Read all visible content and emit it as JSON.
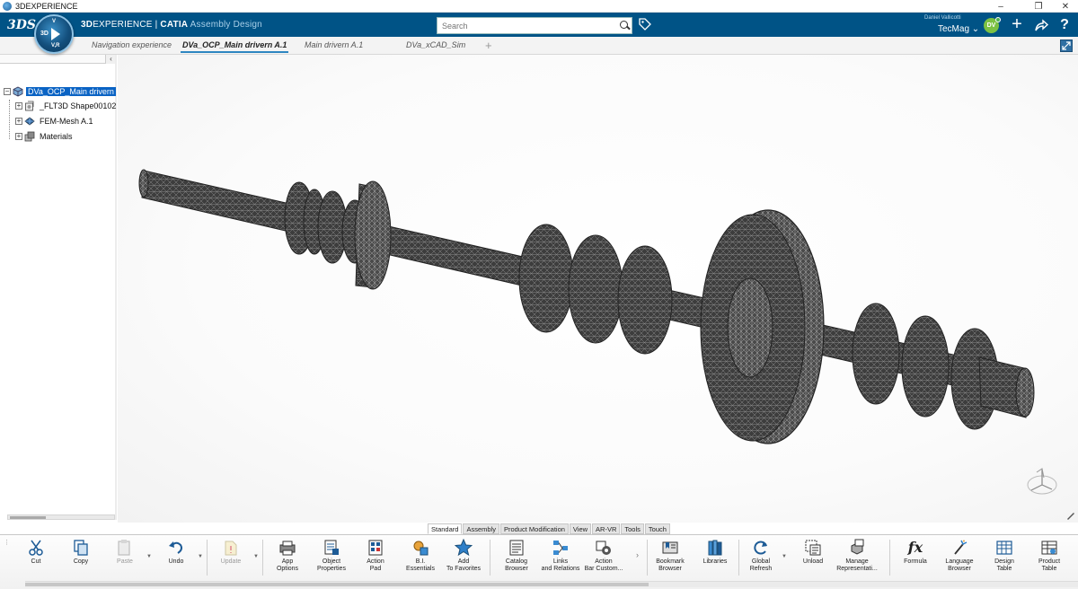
{
  "window": {
    "title": "3DEXPERIENCE"
  },
  "header": {
    "logo_text": "3DS",
    "compass": {
      "left": "3D",
      "top": "V",
      "bottom": "V,R"
    },
    "brand_prefix": "3D",
    "brand_main": "EXPERIENCE",
    "brand_sep": " | ",
    "brand_app": "CATIA",
    "brand_workbench": "Assembly Design",
    "search_placeholder": "Search",
    "user_name": "Daniel Vallicotti",
    "tenant": "TecMag",
    "avatar_initials": "DV"
  },
  "tabs": [
    {
      "label": "Navigation experience",
      "active": false
    },
    {
      "label": "DVa_OCP_Main drivern A.1",
      "active": true
    },
    {
      "label": "Main drivern A.1",
      "active": false
    },
    {
      "label": "DVa_xCAD_Sim",
      "active": false
    }
  ],
  "tree": {
    "collapse_glyph": "‹",
    "items": [
      {
        "label": "DVa_OCP_Main drivern",
        "selected": true,
        "icon": "product-icon"
      },
      {
        "label": "_FLT3D Shape00102",
        "selected": false,
        "icon": "shape-icon"
      },
      {
        "label": "FEM-Mesh A.1",
        "selected": false,
        "icon": "fem-mesh-icon"
      },
      {
        "label": "Materials",
        "selected": false,
        "icon": "materials-icon"
      }
    ]
  },
  "section_tabs": [
    {
      "label": "Standard",
      "active": true
    },
    {
      "label": "Assembly",
      "active": false
    },
    {
      "label": "Product Modification",
      "active": false
    },
    {
      "label": "View",
      "active": false
    },
    {
      "label": "AR-VR",
      "active": false
    },
    {
      "label": "Tools",
      "active": false
    },
    {
      "label": "Touch",
      "active": false
    }
  ],
  "actions": {
    "cut": "Cut",
    "copy": "Copy",
    "paste": "Paste",
    "undo": "Undo",
    "update": "Update",
    "app_options": "App\nOptions",
    "object_properties": "Object\nProperties",
    "action_pad": "Action\nPad",
    "bi_essentials": "B.I.\nEssentials",
    "add_favorites": "Add\nTo Favorites",
    "catalog_browser": "Catalog\nBrowser",
    "links_relations": "Links\nand Relations",
    "action_bar_custom": "Action\nBar Custom...",
    "bookmark_browser": "Bookmark\nBrowser",
    "libraries": "Libraries",
    "global_refresh": "Global\nRefresh",
    "unload": "Unload",
    "manage_rep": "Manage\nRepresentati...",
    "formula": "Formula",
    "language_browser": "Language\nBrowser",
    "design_table": "Design\nTable",
    "product_table": "Product\nTable"
  },
  "colors": {
    "top_bar": "#005386",
    "selection": "#0a63c4",
    "accent": "#2e86c1"
  }
}
